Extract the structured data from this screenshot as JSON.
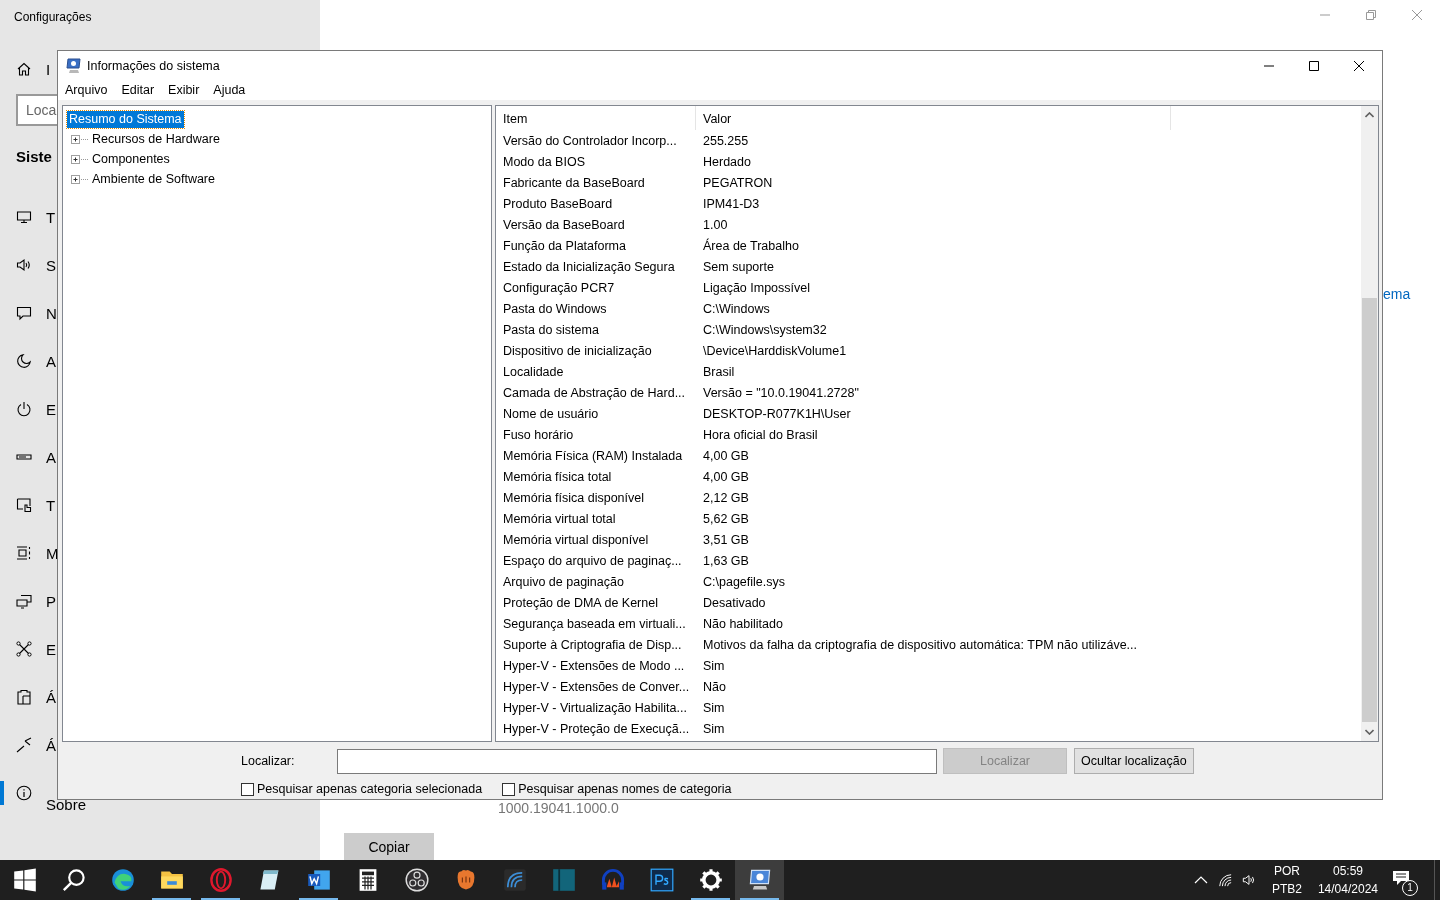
{
  "settings_window": {
    "title": "Configurações",
    "sidebar": {
      "home_label": "I",
      "search_placeholder": "Loca",
      "heading": "Siste",
      "items": [
        {
          "kind": "display",
          "label": "T",
          "selected": false
        },
        {
          "kind": "sound",
          "label": "S",
          "selected": false
        },
        {
          "kind": "notification",
          "label": "N",
          "selected": false
        },
        {
          "kind": "moon",
          "label": "A",
          "selected": false
        },
        {
          "kind": "power",
          "label": "E",
          "selected": false
        },
        {
          "kind": "battery",
          "label": "A",
          "selected": false
        },
        {
          "kind": "tablet",
          "label": "T",
          "selected": false
        },
        {
          "kind": "multitask",
          "label": "M",
          "selected": false
        },
        {
          "kind": "projecting",
          "label": "P",
          "selected": false
        },
        {
          "kind": "shared",
          "label": "E",
          "selected": false
        },
        {
          "kind": "clipboard",
          "label": "Á",
          "selected": false
        },
        {
          "kind": "remote",
          "label": "Á",
          "selected": false
        },
        {
          "kind": "info",
          "label": "Sobre",
          "selected": true
        }
      ]
    },
    "content": {
      "link": "ema",
      "version": "1000.19041.1000.0",
      "button": "Copiar"
    }
  },
  "dialog": {
    "title": "Informações do sistema",
    "menu": [
      "Arquivo",
      "Editar",
      "Exibir",
      "Ajuda"
    ],
    "tree": [
      {
        "label": "Resumo do Sistema",
        "kind": "leaf",
        "selected": true
      },
      {
        "label": "Recursos de Hardware",
        "kind": "node",
        "selected": false
      },
      {
        "label": "Componentes",
        "kind": "node",
        "selected": false
      },
      {
        "label": "Ambiente de Software",
        "kind": "node",
        "selected": false
      }
    ],
    "table": {
      "columns": [
        "Item",
        "Valor"
      ],
      "rows": [
        {
          "item": "Versão do Controlador Incorp...",
          "value": "255.255"
        },
        {
          "item": "Modo da BIOS",
          "value": "Herdado"
        },
        {
          "item": "Fabricante da BaseBoard",
          "value": "PEGATRON"
        },
        {
          "item": "Produto BaseBoard",
          "value": "IPM41-D3"
        },
        {
          "item": "Versão da BaseBoard",
          "value": "1.00"
        },
        {
          "item": "Função da Plataforma",
          "value": "Área de Trabalho"
        },
        {
          "item": "Estado da Inicialização Segura",
          "value": "Sem suporte"
        },
        {
          "item": "Configuração PCR7",
          "value": "Ligação Impossível"
        },
        {
          "item": "Pasta do Windows",
          "value": "C:\\Windows"
        },
        {
          "item": "Pasta do sistema",
          "value": "C:\\Windows\\system32"
        },
        {
          "item": "Dispositivo de inicialização",
          "value": "\\Device\\HarddiskVolume1"
        },
        {
          "item": "Localidade",
          "value": "Brasil"
        },
        {
          "item": "Camada de Abstração de Hard...",
          "value": "Versão = \"10.0.19041.2728\""
        },
        {
          "item": "Nome de usuário",
          "value": "DESKTOP-R077K1H\\User"
        },
        {
          "item": "Fuso horário",
          "value": "Hora oficial do Brasil"
        },
        {
          "item": "Memória Física (RAM) Instalada",
          "value": "4,00 GB"
        },
        {
          "item": "Memória física total",
          "value": "4,00 GB"
        },
        {
          "item": "Memória física disponível",
          "value": "2,12 GB"
        },
        {
          "item": "Memória virtual total",
          "value": "5,62 GB"
        },
        {
          "item": "Memória virtual disponível",
          "value": "3,51 GB"
        },
        {
          "item": "Espaço do arquivo de paginaç...",
          "value": "1,63 GB"
        },
        {
          "item": "Arquivo de paginação",
          "value": "C:\\pagefile.sys"
        },
        {
          "item": "Proteção de DMA de Kernel",
          "value": "Desativado"
        },
        {
          "item": "Segurança baseada em virtuali...",
          "value": "Não habilitado"
        },
        {
          "item": "Suporte à Criptografia de Disp...",
          "value": "Motivos da falha da criptografia de dispositivo automática: TPM não utilizáve..."
        },
        {
          "item": "Hyper-V - Extensões de Modo ...",
          "value": "Sim"
        },
        {
          "item": "Hyper-V - Extensões de Conver...",
          "value": "Não"
        },
        {
          "item": "Hyper-V - Virtualização Habilita...",
          "value": "Sim"
        },
        {
          "item": "Hyper-V - Proteção de Execuçã...",
          "value": "Sim"
        }
      ]
    },
    "find": {
      "label": "Localizar:",
      "buttons": [
        {
          "label": "Localizar",
          "disabled": true
        },
        {
          "label": "Ocultar localização",
          "disabled": false
        }
      ],
      "options": [
        {
          "label": "Pesquisar apenas categoria selecionada",
          "checked": false
        },
        {
          "label": "Pesquisar apenas nomes de categoria",
          "checked": false
        }
      ]
    }
  },
  "taskbar": {
    "apps": [
      {
        "kind": "start",
        "running": false,
        "selected": false
      },
      {
        "kind": "search",
        "running": false,
        "selected": false
      },
      {
        "kind": "edge",
        "running": false,
        "selected": false
      },
      {
        "kind": "folder",
        "running": true,
        "selected": false
      },
      {
        "kind": "opera",
        "running": true,
        "selected": false
      },
      {
        "kind": "notepad",
        "running": false,
        "selected": false
      },
      {
        "kind": "word",
        "running": true,
        "selected": false
      },
      {
        "kind": "calculator",
        "running": false,
        "selected": false
      },
      {
        "kind": "obs",
        "running": false,
        "selected": false
      },
      {
        "kind": "glove",
        "running": false,
        "selected": false
      },
      {
        "kind": "spiral",
        "running": false,
        "selected": false
      },
      {
        "kind": "book",
        "running": false,
        "selected": false
      },
      {
        "kind": "headphones",
        "running": false,
        "selected": false
      },
      {
        "kind": "ps",
        "running": false,
        "selected": false
      },
      {
        "kind": "gear",
        "running": true,
        "selected": false
      },
      {
        "kind": "sysinfo",
        "running": true,
        "selected": true
      }
    ],
    "language": "POR",
    "layout": "PTB2",
    "time": "05:59",
    "date": "14/04/2024",
    "notifications": "1"
  }
}
